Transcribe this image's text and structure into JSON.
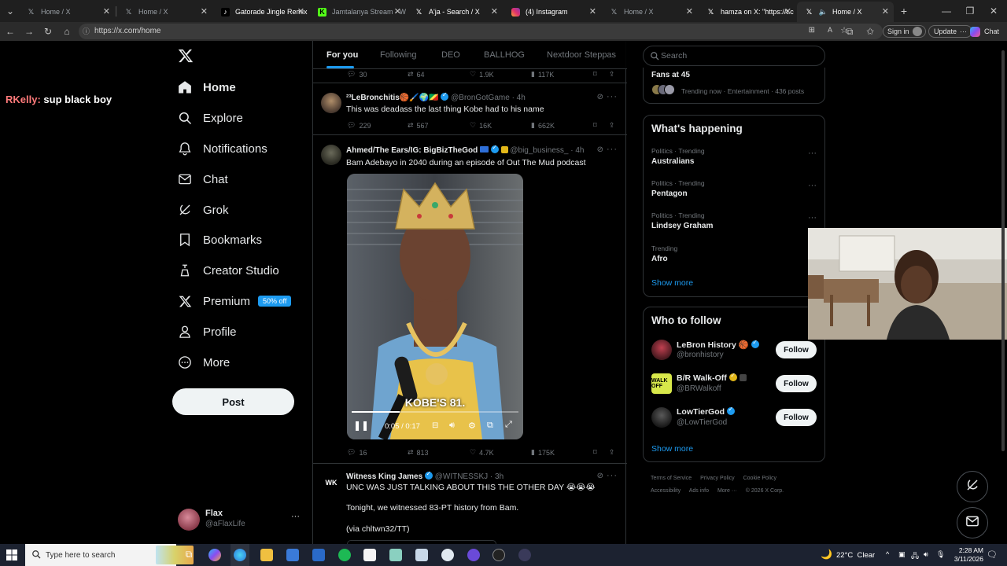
{
  "browser": {
    "tabs": [
      {
        "title": "Home / X",
        "icon": "x-logo-icon",
        "active": false
      },
      {
        "title": "Home / X",
        "icon": "x-logo-icon",
        "active": false
      },
      {
        "title": "Gatorade Jingle Remix -",
        "icon": "tiktok-icon",
        "active": false
      },
      {
        "title": "Jamtalanya Stream - W",
        "icon": "kick-icon",
        "active": false
      },
      {
        "title": "A'ja - Search / X",
        "icon": "x-logo-icon",
        "active": false
      },
      {
        "title": "(4) Instagram",
        "icon": "instagram-icon",
        "active": false
      },
      {
        "title": "Home / X",
        "icon": "x-logo-icon",
        "active": false
      },
      {
        "title": "hamza on X: \"https://t.c",
        "icon": "x-logo-icon",
        "active": false
      },
      {
        "title": "Home / X",
        "icon": "x-logo-icon",
        "active": true
      }
    ],
    "url": "https://x.com/home",
    "sign_in": "Sign in",
    "update": "Update",
    "chat": "Chat"
  },
  "overlay": {
    "name": "RKelly:",
    "message": "sup black boy"
  },
  "nav": {
    "items": [
      {
        "label": "Home",
        "icon": "home-icon"
      },
      {
        "label": "Explore",
        "icon": "search-icon"
      },
      {
        "label": "Notifications",
        "icon": "bell-icon"
      },
      {
        "label": "Chat",
        "icon": "mail-icon"
      },
      {
        "label": "Grok",
        "icon": "grok-icon"
      },
      {
        "label": "Bookmarks",
        "icon": "bookmark-icon"
      },
      {
        "label": "Creator Studio",
        "icon": "creator-studio-icon"
      },
      {
        "label": "Premium",
        "icon": "x-logo-icon"
      },
      {
        "label": "Profile",
        "icon": "person-icon"
      },
      {
        "label": "More",
        "icon": "more-circle-icon"
      }
    ],
    "premium_badge": "50% off",
    "post_button": "Post",
    "account": {
      "name": "Flax",
      "handle": "@aFlaxLife"
    }
  },
  "feed_tabs": [
    "For you",
    "Following",
    "DEO",
    "BALLHOG",
    "Nextdoor Steppas"
  ],
  "tweets": [
    {
      "stats": {
        "replies": "30",
        "reposts": "64",
        "likes": "1.9K",
        "views": "117K"
      }
    },
    {
      "name": "²³LeBronchitis🏀🖌️🌍🇨🇬",
      "handle": "@BronGotGame",
      "time": "· 4h",
      "text": "This was deadass the last thing Kobe had to his name",
      "stats": {
        "replies": "229",
        "reposts": "567",
        "likes": "16K",
        "views": "662K"
      }
    },
    {
      "name": "Ahmed/The Ears/IG: BigBizTheGod",
      "handle": "@big_business_",
      "time": "· 4h",
      "text": "Bam Adebayo in 2040 during an episode of Out The Mud podcast",
      "video": {
        "caption": "KOBE'S 81.",
        "time": "0:05 / 0:17",
        "progress": 0.29
      },
      "stats": {
        "replies": "16",
        "reposts": "813",
        "likes": "4.7K",
        "views": "175K"
      }
    },
    {
      "name": "Witness King James",
      "handle": "@WITNESSKJ",
      "time": "· 3h",
      "text": "UNC WAS JUST TALKING ABOUT THIS THE OTHER DAY 😭😭😭",
      "text2": "Tonight, we witnessed 83-PT history from Bam.",
      "text3": "(via chltwn32/TT)"
    }
  ],
  "sidebar": {
    "search_placeholder": "Search",
    "top_trend": {
      "title": "Fans at 45",
      "meta": "Trending now · Entertainment · 436 posts"
    },
    "whats_happening": "What's happening",
    "trends": [
      {
        "category": "Politics · Trending",
        "name": "Australians"
      },
      {
        "category": "Politics · Trending",
        "name": "Pentagon"
      },
      {
        "category": "Politics · Trending",
        "name": "Lindsey Graham"
      },
      {
        "category": "Trending",
        "name": "Afro"
      }
    ],
    "show_more": "Show more",
    "who_to_follow": "Who to follow",
    "follow_suggestions": [
      {
        "name": "LeBron History 🏀",
        "handle": "@bronhistory",
        "button": "Follow"
      },
      {
        "name": "B/R Walk-Off",
        "handle": "@BRWalkoff",
        "button": "Follow"
      },
      {
        "name": "LowTierGod",
        "handle": "@LowTierGod",
        "button": "Follow"
      }
    ],
    "footer": [
      "Terms of Service",
      "Privacy Policy",
      "Cookie Policy",
      "Accessibility",
      "Ads info",
      "More ···",
      "© 2026 X Corp."
    ]
  },
  "taskbar": {
    "search_placeholder": "Type here to search",
    "weather": "22°C  Clear",
    "time": "2:28 AM",
    "date": "3/11/2026"
  }
}
